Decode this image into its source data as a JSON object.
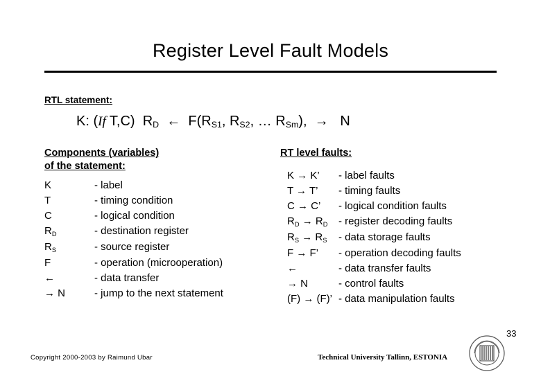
{
  "slide": {
    "title": "Register Level Fault Models",
    "page_number": "33",
    "rtl_heading": "RTL statement:",
    "statement": {
      "prefix": "K: (",
      "italic_if": "If",
      "cond": " T,C)",
      "dest": "R",
      "dest_sub": "D",
      "arrow_left": "←",
      "func": "F(R",
      "src1_sub": "S1",
      "sep1": ", R",
      "src2_sub": "S2",
      "sep2": ", … R",
      "srcm_sub": "Sm",
      "close": "),",
      "arrow_right": "→",
      "next": "N"
    },
    "left_column": {
      "heading_line1": "Components (variables)",
      "heading_line2": "of the statement:",
      "rows": [
        {
          "symbol": "K",
          "desc": "- label"
        },
        {
          "symbol": "T",
          "desc": "- timing condition"
        },
        {
          "symbol": "C",
          "desc": "- logical condition"
        },
        {
          "symbol": "R<sub>D</sub>",
          "desc": "- destination register"
        },
        {
          "symbol": "R<sub>S</sub>",
          "desc": "- source register"
        },
        {
          "symbol": "F",
          "desc": "- operation (microoperation)"
        },
        {
          "symbol": "←",
          "desc": "- data transfer"
        },
        {
          "symbol": "→ N",
          "desc": "- jump to the next statement"
        }
      ]
    },
    "right_column": {
      "heading": "RT level faults:",
      "rows": [
        {
          "symbol": "K → K’",
          "desc": "- label faults"
        },
        {
          "symbol": "T →  T’",
          "desc": "- timing faults"
        },
        {
          "symbol": "C → C’",
          "desc": "- logical condition faults"
        },
        {
          "symbol": "R<sub>D</sub> → R<sub>D</sub>",
          "desc": "- register decoding faults"
        },
        {
          "symbol": "R<sub>S</sub> → R<sub>S</sub>",
          "desc": "- data storage faults"
        },
        {
          "symbol": "F → F’",
          "desc": "- operation decoding faults"
        },
        {
          "symbol": "←",
          "desc": "- data transfer faults"
        },
        {
          "symbol": "→ N",
          "desc": "- control faults"
        },
        {
          "symbol": "(F) → (F)’",
          "desc": "- data manipulation faults"
        }
      ]
    },
    "footer": {
      "copyright": "Copyright 2000-2003 by Raimund Ubar",
      "affiliation": "Technical University Tallinn, ESTONIA",
      "logo_text": "TALLINN TECHNICAL UNIVERSITY"
    }
  }
}
